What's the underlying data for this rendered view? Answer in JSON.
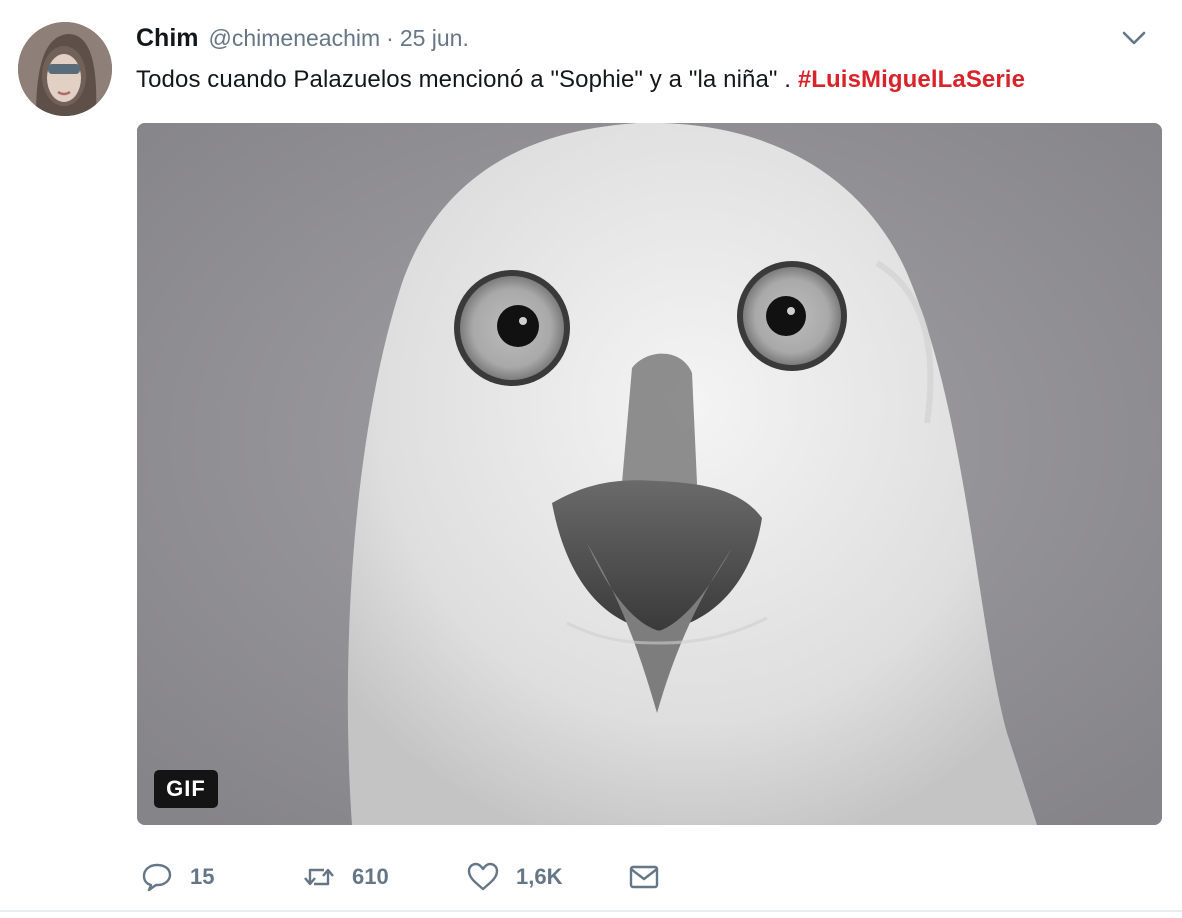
{
  "user": {
    "name": "Chim",
    "handle": "@chimeneachim",
    "separator": "·",
    "date": "25 jun."
  },
  "tweet": {
    "text": "Todos cuando Palazuelos mencionó a \"Sophie\" y a \"la niña\" . ",
    "hashtag": "#LuisMiguelLaSerie"
  },
  "media": {
    "badge": "GIF"
  },
  "actions": {
    "replies": "15",
    "retweets": "610",
    "likes": "1,6K"
  },
  "icons": {
    "caret": "chevron-down-icon",
    "reply": "reply-icon",
    "retweet": "retweet-icon",
    "like": "heart-icon",
    "dm": "envelope-icon"
  },
  "colors": {
    "hashtag": "#d8232a",
    "secondary_text": "#657786",
    "media_background": "#8d8c90"
  }
}
